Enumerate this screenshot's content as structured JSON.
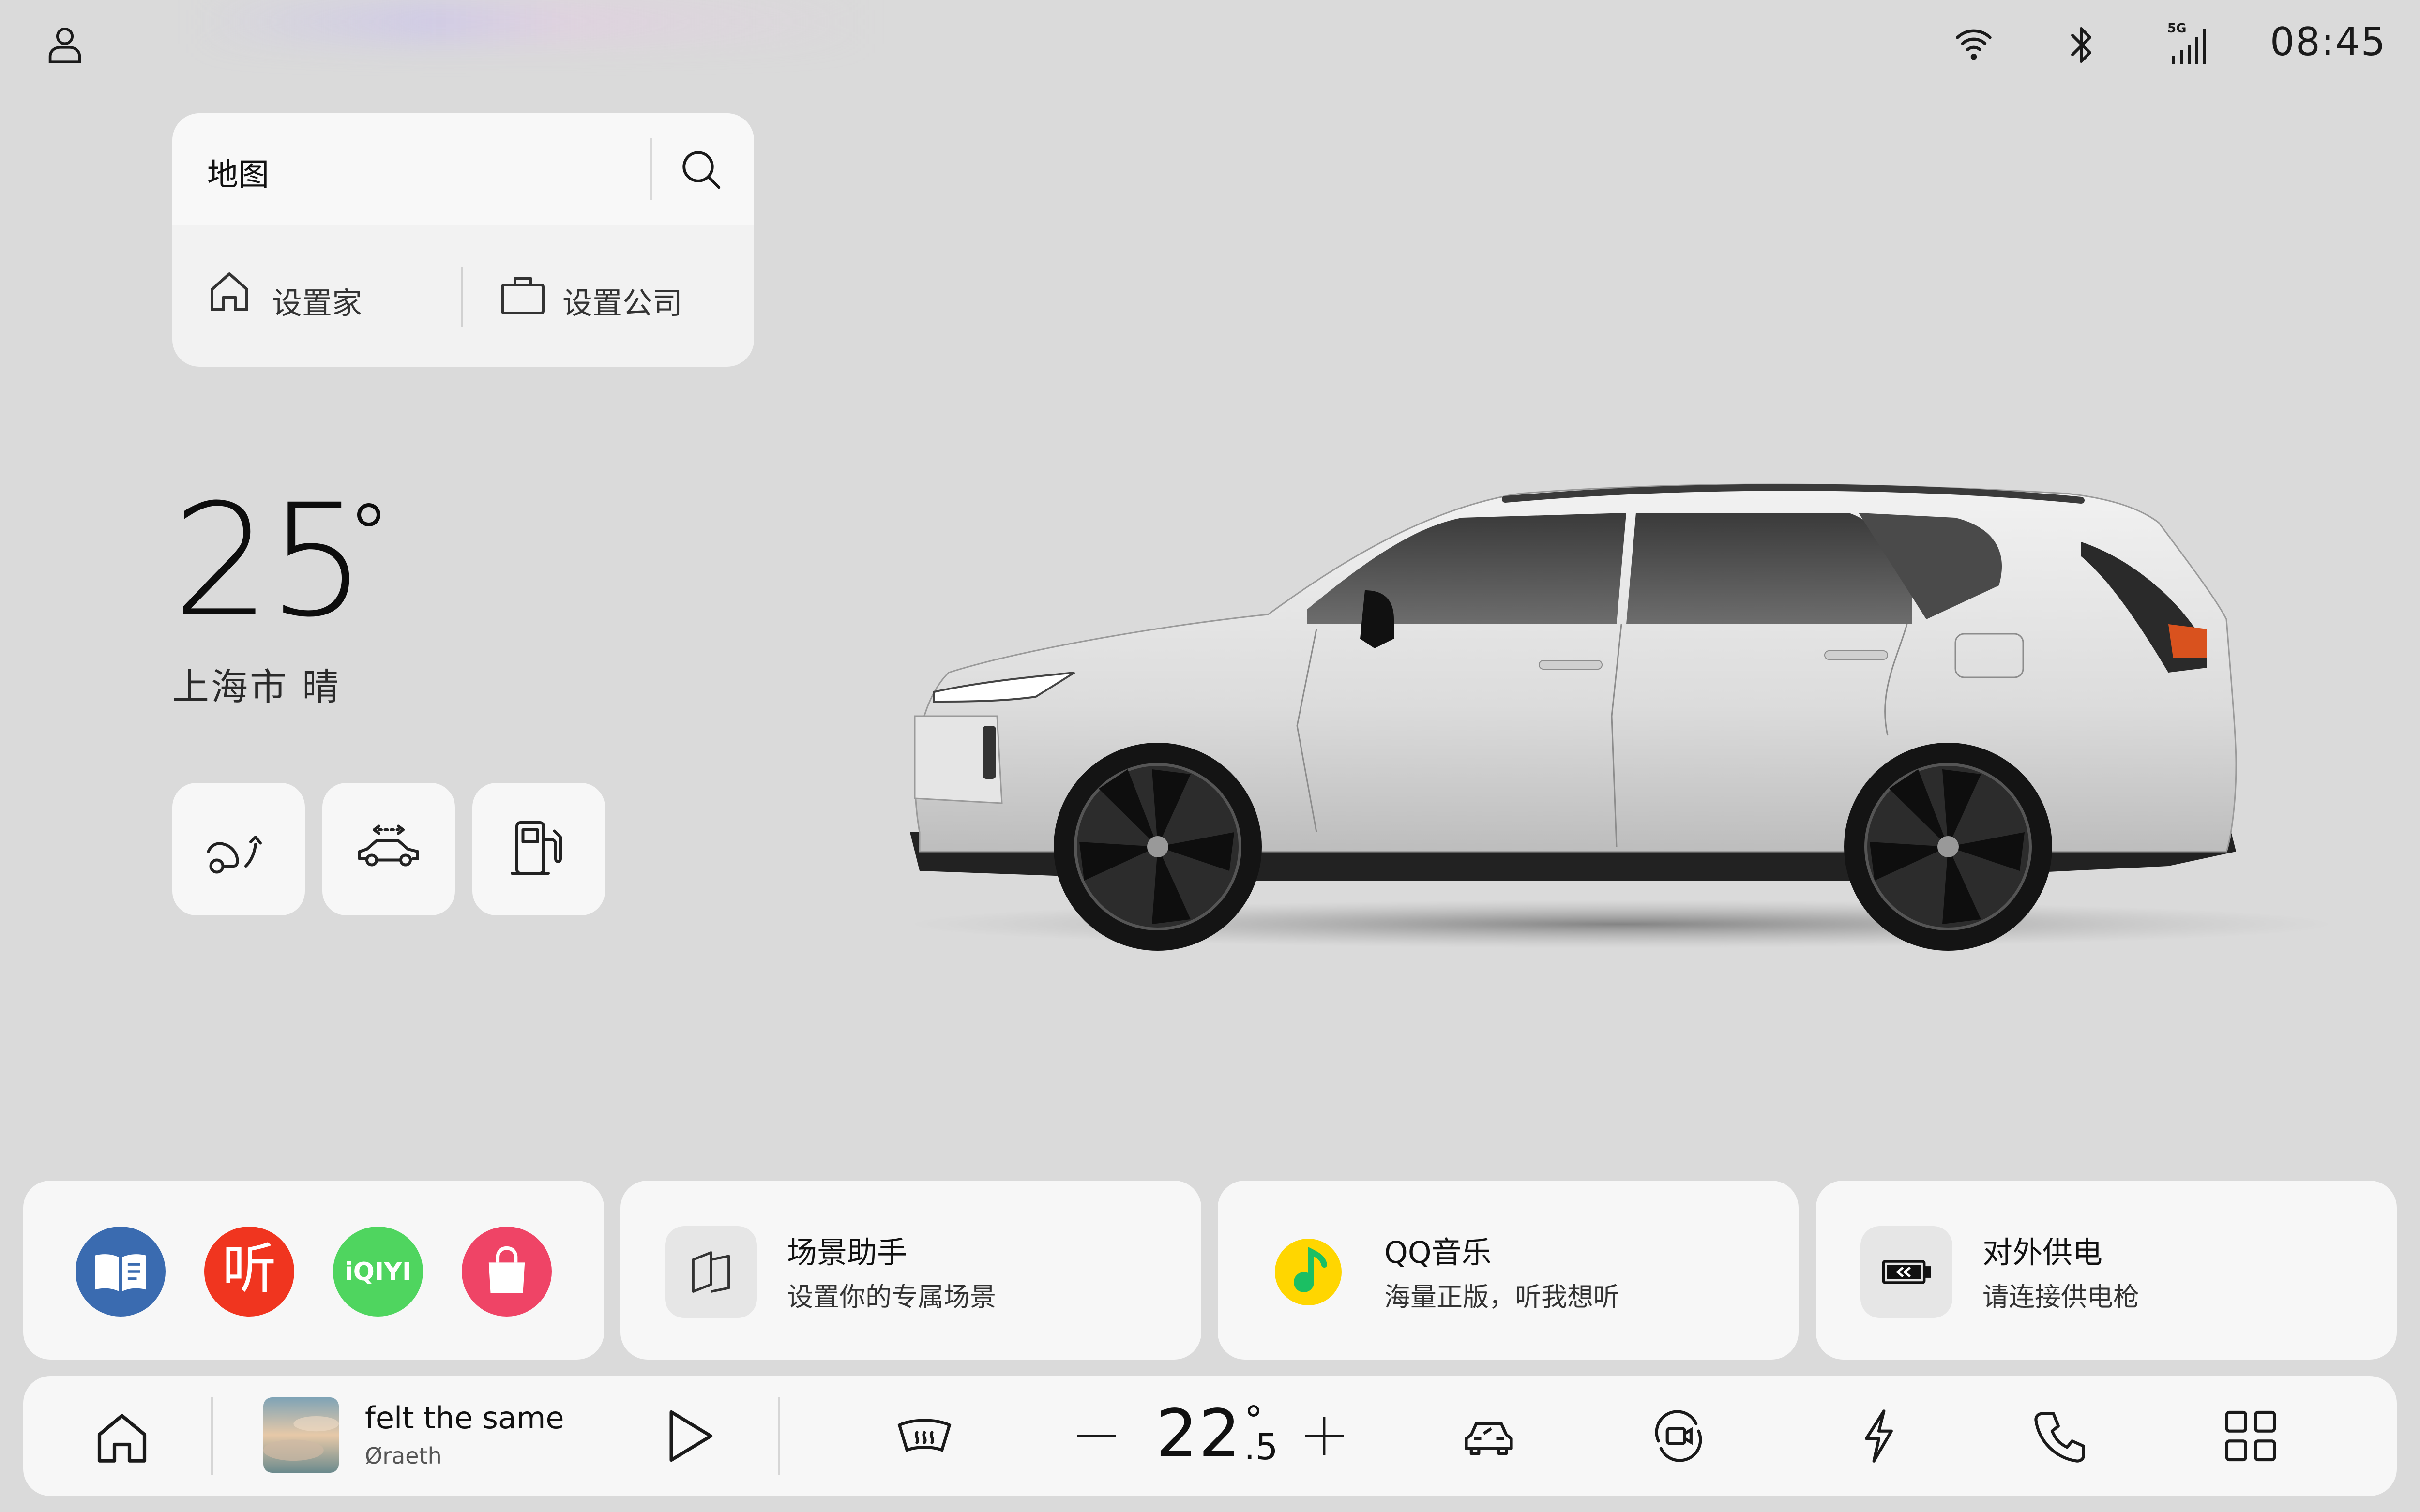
{
  "status_bar": {
    "time": "08:45",
    "network_label": "5G",
    "icons": [
      "user-icon",
      "wifi-icon",
      "bluetooth-icon",
      "signal-5g-icon"
    ]
  },
  "map": {
    "title": "地图",
    "home_label": "设置家",
    "work_label": "设置公司"
  },
  "weather": {
    "temperature": "25",
    "description": "上海市 晴"
  },
  "quick_controls": [
    "trunk-icon",
    "car-height-icon",
    "fuel-pump-icon"
  ],
  "apps": [
    "book-app-icon",
    "ting-app-icon",
    "iqiyi-app-icon",
    "store-app-icon"
  ],
  "apps_labels": {
    "ting": "听",
    "iqiyi": "iQIYI"
  },
  "widgets": [
    {
      "title": "场景助手",
      "subtitle": "设置你的专属场景",
      "icon": "scene-icon"
    },
    {
      "title": "QQ音乐",
      "subtitle": "海量正版，听我想听",
      "icon": "qq-music-icon"
    },
    {
      "title": "对外供电",
      "subtitle": "请连接供电枪",
      "icon": "battery-discharge-icon"
    }
  ],
  "dock": {
    "track_title": "felt the same",
    "track_artist": "Øraeth",
    "temp_integer": "22",
    "temp_decimal": ".5"
  },
  "colors": {
    "background": "#dadada",
    "card": "#f7f7f7",
    "book_app": "#3a6bb0",
    "ting_app": "#f0351f",
    "iqiyi_app": "#4fd55f",
    "store_app": "#ef4466",
    "qq_music_yellow": "#ffd600",
    "qq_music_green": "#1bbf63"
  }
}
